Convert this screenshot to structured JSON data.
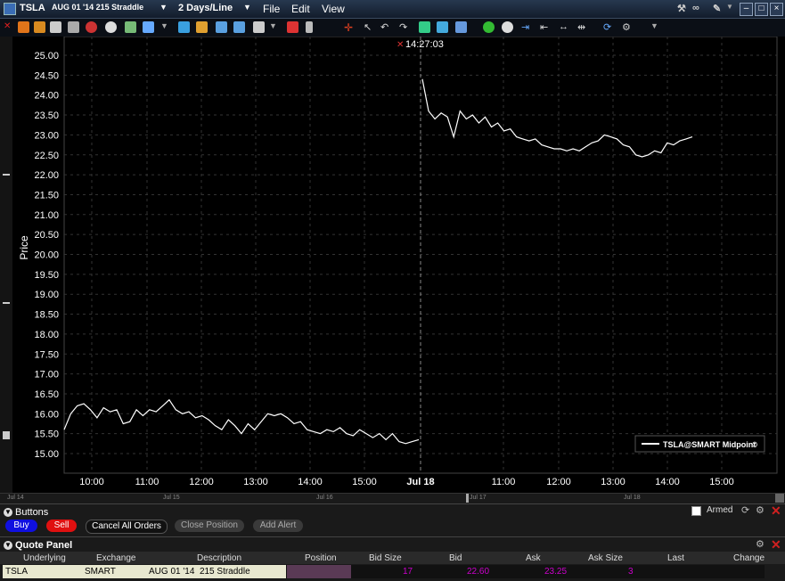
{
  "window": {
    "symbol": "TSLA",
    "contract": "AUG 01 '14 215 Straddle",
    "period": "2 Days/Line",
    "menu": [
      "File",
      "Edit",
      "View"
    ]
  },
  "toolbar": {
    "icons": [
      "crosshair-icon",
      "cursor-icon",
      "refresh-icon",
      "settings-icon"
    ]
  },
  "cursor_time": "14:27:03",
  "chart_data": {
    "type": "line",
    "ylabel": "Price",
    "ylim": [
      14.85,
      25.1
    ],
    "yticks": [
      "25.00",
      "24.50",
      "24.00",
      "23.50",
      "23.00",
      "22.50",
      "22.00",
      "21.50",
      "21.00",
      "20.50",
      "20.00",
      "19.50",
      "19.00",
      "18.50",
      "18.00",
      "17.50",
      "17.00",
      "16.50",
      "16.00",
      "15.50",
      "15.00"
    ],
    "x_labels_day1": [
      "10:00",
      "11:00",
      "12:00",
      "13:00",
      "14:00",
      "15:00"
    ],
    "separator_label": "Jul 18",
    "x_labels_day2": [
      "11:00",
      "12:00",
      "13:00",
      "14:00",
      "15:00"
    ],
    "legend": "TSLA@SMART Midpoint",
    "grid": true,
    "series": [
      {
        "name": "TSLA@SMART Midpoint",
        "day1": [
          15.6,
          16.0,
          16.2,
          16.25,
          16.1,
          15.9,
          16.15,
          16.05,
          16.1,
          15.75,
          15.8,
          16.1,
          15.95,
          16.1,
          16.05,
          16.2,
          16.35,
          16.1,
          16.0,
          16.05,
          15.9,
          15.95,
          15.85,
          15.7,
          15.6,
          15.85,
          15.7,
          15.5,
          15.75,
          15.6,
          15.8,
          16.0,
          15.95,
          16.0,
          15.9,
          15.75,
          15.8,
          15.6,
          15.55,
          15.5,
          15.6,
          15.55,
          15.65,
          15.5,
          15.45,
          15.6,
          15.5,
          15.4,
          15.5,
          15.35,
          15.5,
          15.3,
          15.25,
          15.3,
          15.35
        ],
        "day2": [
          24.4,
          23.6,
          23.4,
          23.55,
          23.45,
          22.95,
          23.6,
          23.4,
          23.5,
          23.3,
          23.45,
          23.2,
          23.3,
          23.1,
          23.15,
          22.95,
          22.9,
          22.85,
          22.9,
          22.75,
          22.7,
          22.65,
          22.65,
          22.6,
          22.65,
          22.6,
          22.7,
          22.8,
          22.85,
          23.0,
          22.95,
          22.9,
          22.75,
          22.7,
          22.5,
          22.45,
          22.5,
          22.6,
          22.55,
          22.8,
          22.75,
          22.85,
          22.9,
          22.95
        ]
      }
    ]
  },
  "scroll_dates": [
    "Jul 14",
    "Jul 15",
    "Jul 16",
    "Jul 17",
    "Jul 18"
  ],
  "buttons_panel": {
    "title": "Buttons",
    "buy": "Buy",
    "sell": "Sell",
    "cancel_all": "Cancel All Orders",
    "close_position": "Close Position",
    "add_alert": "Add Alert",
    "armed": "Armed"
  },
  "quote_panel": {
    "title": "Quote Panel",
    "headers": [
      "Underlying",
      "Exchange",
      "Description",
      "Position",
      "Bid Size",
      "Bid",
      "Ask",
      "Ask Size",
      "Last",
      "Change"
    ],
    "row": {
      "underlying": "TSLA",
      "exchange": "SMART",
      "description": "AUG 01 '14  215 Straddle",
      "position": "",
      "bid_size": "17",
      "bid": "22.60",
      "ask": "23.25",
      "ask_size": "3",
      "last": "",
      "change": ""
    }
  },
  "colors": {
    "accent": "#cc00cc",
    "buy": "#1010e0",
    "sell": "#e01010",
    "line": "#ffffff"
  }
}
